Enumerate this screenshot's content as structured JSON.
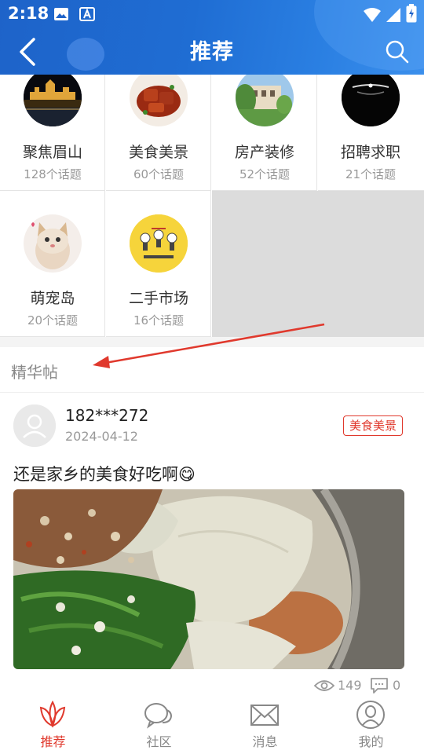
{
  "status_bar": {
    "time": "2:18"
  },
  "header": {
    "title": "推荐"
  },
  "topics": [
    {
      "name": "聚焦眉山",
      "count": "128个话题"
    },
    {
      "name": "美食美景",
      "count": "60个话题"
    },
    {
      "name": "房产装修",
      "count": "52个话题"
    },
    {
      "name": "招聘求职",
      "count": "21个话题"
    },
    {
      "name": "萌宠岛",
      "count": "20个话题"
    },
    {
      "name": "二手市场",
      "count": "16个话题"
    }
  ],
  "section": {
    "title": "精华帖"
  },
  "post": {
    "user": "182***272",
    "date": "2024-04-12",
    "tag": "美食美景",
    "text": "还是家乡的美食好吃啊😋",
    "views": "149",
    "comments": "0"
  },
  "nav": [
    {
      "label": "推荐",
      "active": true
    },
    {
      "label": "社区",
      "active": false
    },
    {
      "label": "消息",
      "active": false
    },
    {
      "label": "我的",
      "active": false
    }
  ],
  "colors": {
    "header": "#1f6dd3",
    "accent": "#e0392d",
    "annotation_arrow": "#e0392d"
  }
}
